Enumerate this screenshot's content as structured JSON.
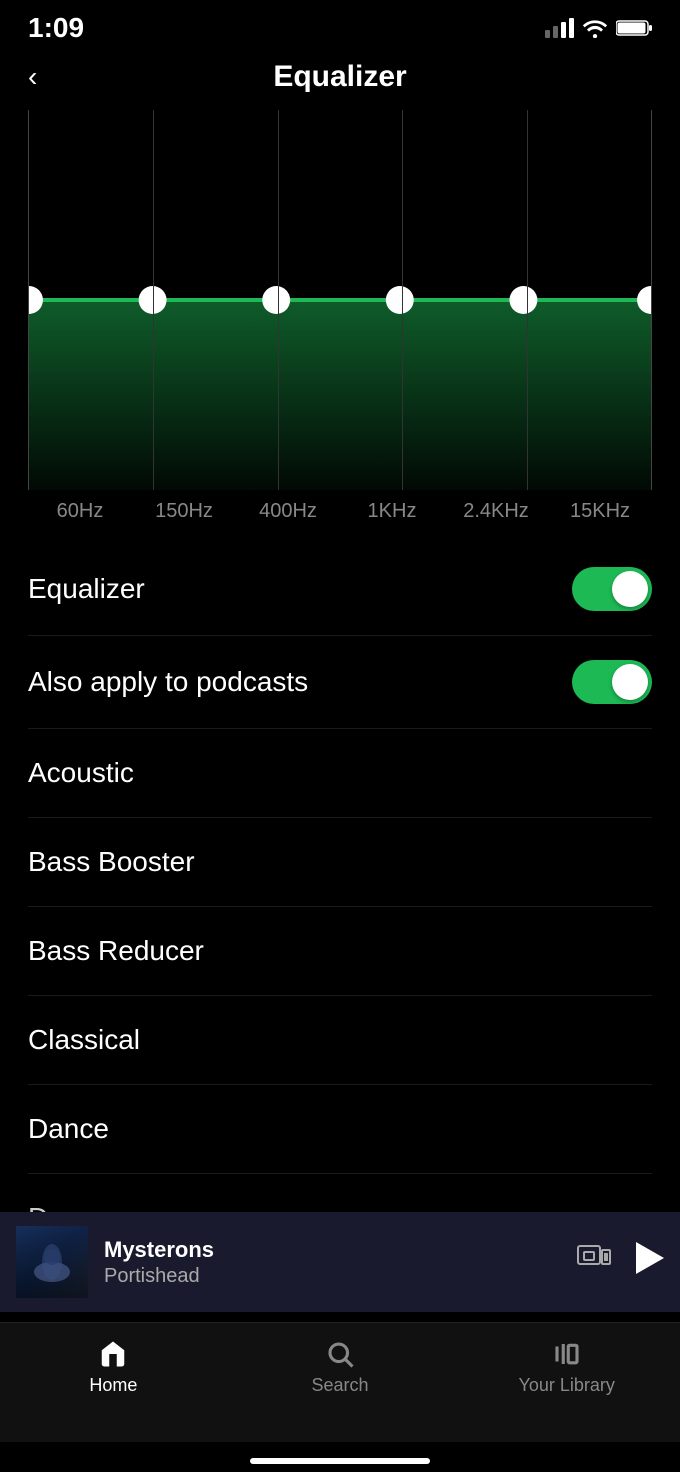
{
  "statusBar": {
    "time": "1:09"
  },
  "header": {
    "backLabel": "<",
    "title": "Equalizer"
  },
  "eqChart": {
    "frequencies": [
      "60Hz",
      "150Hz",
      "400Hz",
      "1KHz",
      "2.4KHz",
      "15KHz"
    ],
    "points": [
      0,
      0,
      0,
      0,
      0,
      0
    ],
    "lineColor": "#1db954",
    "fillColor": "rgba(29,185,84,0.3)"
  },
  "settings": [
    {
      "id": "equalizer-toggle",
      "label": "Equalizer",
      "enabled": true
    },
    {
      "id": "podcasts-toggle",
      "label": "Also apply to podcasts",
      "enabled": true
    }
  ],
  "presets": [
    {
      "label": "Acoustic"
    },
    {
      "label": "Bass Booster"
    },
    {
      "label": "Bass Reducer"
    },
    {
      "label": "Classical"
    },
    {
      "label": "Dance"
    },
    {
      "label": "Deep"
    }
  ],
  "nowPlaying": {
    "title": "Mysterons",
    "artist": "Portishead"
  },
  "bottomNav": [
    {
      "id": "home",
      "label": "Home",
      "active": true
    },
    {
      "id": "search",
      "label": "Search",
      "active": false
    },
    {
      "id": "library",
      "label": "Your Library",
      "active": false
    }
  ]
}
